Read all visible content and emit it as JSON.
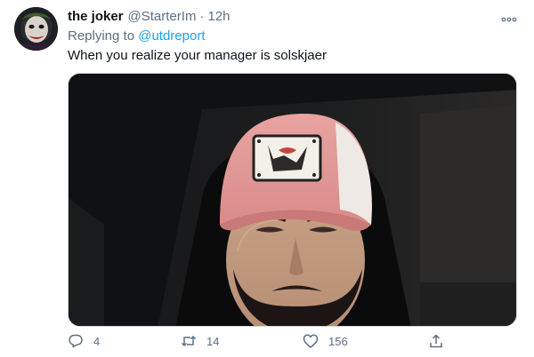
{
  "tweet": {
    "name": "the joker",
    "handle": "@StarterIm",
    "separator": "·",
    "time": "12h",
    "replying_prefix": "Replying to",
    "replying_to": "@utdreport",
    "text": "When you realize your manager is solskjaer"
  },
  "actions": {
    "reply_count": "4",
    "retweet_count": "14",
    "like_count": "156"
  },
  "icons": {
    "more": "more-icon",
    "reply": "reply-icon",
    "retweet": "retweet-icon",
    "like": "like-icon",
    "share": "share-icon"
  },
  "colors": {
    "link": "#1da1f2",
    "muted": "#5b7083",
    "text": "#0f1419"
  }
}
